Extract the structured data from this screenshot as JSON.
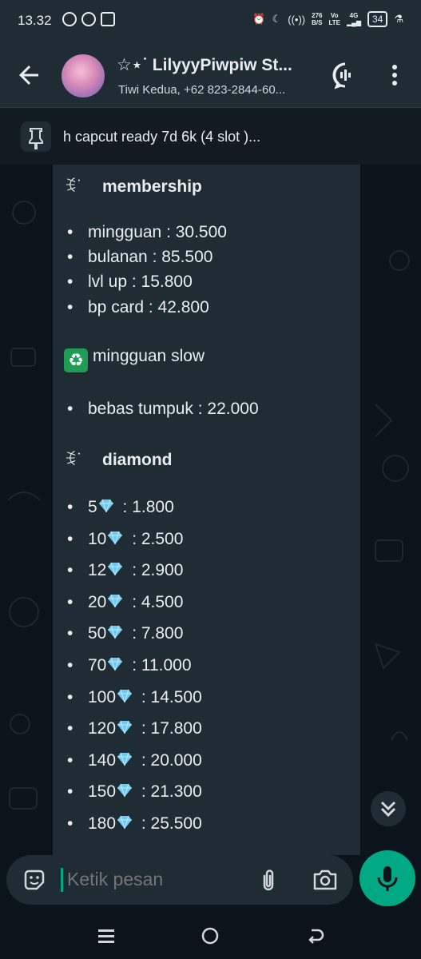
{
  "status_bar": {
    "time": "13.32",
    "network_speed_top": "276",
    "network_speed_unit": "B/S",
    "net_type_1": "Vo",
    "net_type_2": "LTE",
    "net_type_3": "4G",
    "battery": "34"
  },
  "header": {
    "title": "☆⋆˙ LilyyyPiwpiw St...",
    "subtitle": "Tiwi Kedua, +62 823-2844-60..."
  },
  "pinned": {
    "text": "h capcut ready 7d 6k (4 slot )..."
  },
  "message": {
    "membership_heading": "membership",
    "heading_symbol": "ꉂ˙",
    "membership_items": [
      "mingguan : 30.500",
      "bulanan : 85.500",
      "lvl up : 15.800",
      "bp card : 42.800"
    ],
    "slow_heading": "mingguan slow",
    "slow_items": [
      "bebas tumpuk : 22.000"
    ],
    "diamond_heading": "diamond",
    "diamond_items": [
      {
        "qty": "5",
        "price": " : 1.800"
      },
      {
        "qty": "10",
        "price": " : 2.500"
      },
      {
        "qty": "12",
        "price": " : 2.900"
      },
      {
        "qty": "20",
        "price": " : 4.500"
      },
      {
        "qty": "50",
        "price": " : 7.800"
      },
      {
        "qty": "70",
        "price": " : 11.000"
      },
      {
        "qty": "100",
        "price": " : 14.500"
      },
      {
        "qty": "120",
        "price": " : 17.800"
      },
      {
        "qty": "140",
        "price": " : 20.000"
      },
      {
        "qty": "150",
        "price": " : 21.300"
      },
      {
        "qty": "180",
        "price": " : 25.500"
      }
    ],
    "bullet": "•"
  },
  "input": {
    "placeholder": "Ketik pesan"
  },
  "colors": {
    "accent": "#00a884",
    "bubble": "#202c33",
    "header": "#1f2c34",
    "background": "#0b141a"
  },
  "icons": [
    "back-arrow-icon",
    "voice-chat-icon",
    "more-vert-icon",
    "pin-icon",
    "scroll-down-icon",
    "sticker-icon",
    "attach-icon",
    "camera-icon",
    "mic-icon",
    "diamond-icon",
    "recycle-icon"
  ]
}
